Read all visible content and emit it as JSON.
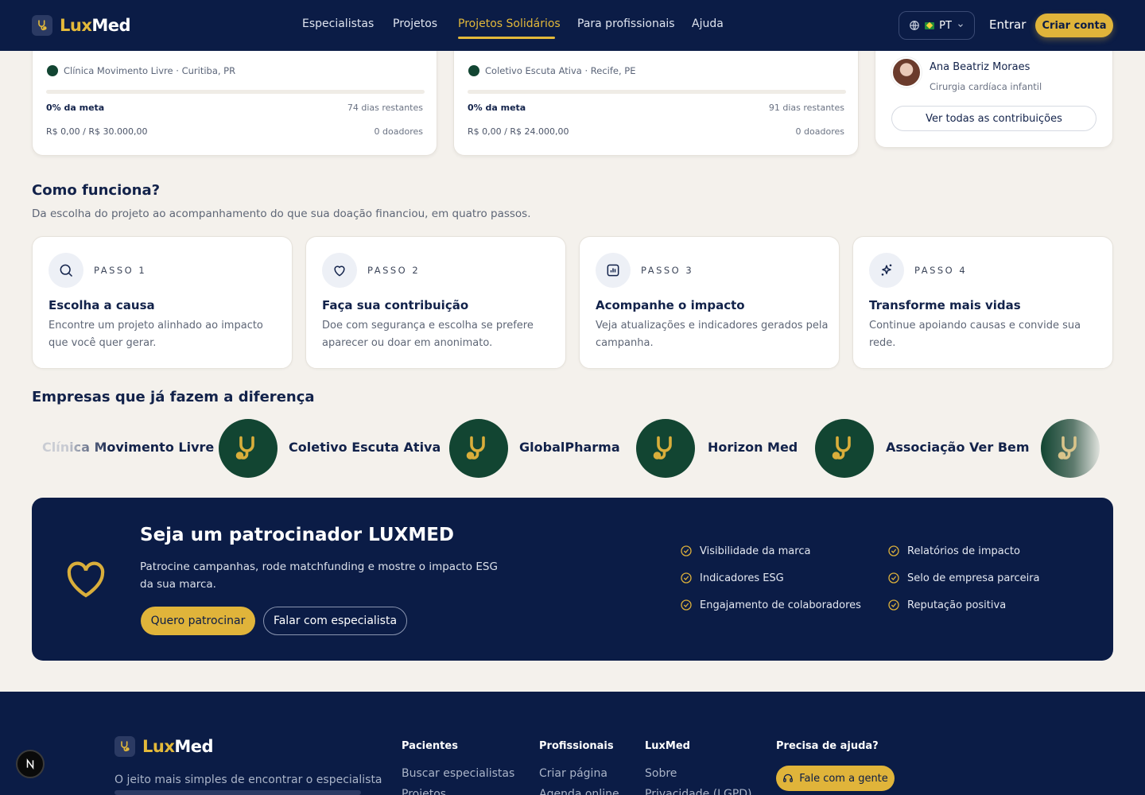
{
  "header": {
    "brand_lux": "Lux",
    "brand_med": "Med",
    "nav": [
      "Especialistas",
      "Projetos",
      "Projetos Solidários",
      "Para profissionais",
      "Ajuda"
    ],
    "lang": "PT",
    "login": "Entrar",
    "signup": "Criar conta"
  },
  "projects": [
    {
      "org": "Clínica Movimento Livre · Curitiba, PR",
      "percent": "0% da meta",
      "days": "74 dias restantes",
      "amount": "R$ 0,00 / R$ 30.000,00",
      "donors": "0 doadores",
      "progress": 0
    },
    {
      "org": "Coletivo Escuta Ativa · Recife, PE",
      "percent": "0% da meta",
      "days": "91 dias restantes",
      "amount": "R$ 0,00 / R$ 24.000,00",
      "donors": "0 doadores",
      "progress": 0
    }
  ],
  "contrib": {
    "name": "Ana Beatriz Moraes",
    "role": "Cirurgia cardíaca infantil",
    "button": "Ver todas as contribuições"
  },
  "how": {
    "title": "Como funciona?",
    "subtitle": "Da escolha do projeto ao acompanhamento do que sua doação financiou, em quatro passos.",
    "steps": [
      {
        "label": "PASSO 1",
        "title": "Escolha a causa",
        "desc1": "Encontre um projeto alinhado ao impacto",
        "desc2": "que você quer gerar.",
        "icon": "search-icon"
      },
      {
        "label": "PASSO 2",
        "title": "Faça sua contribuição",
        "desc1": "Doe com segurança e escolha se prefere",
        "desc2": "aparecer ou doar em anonimato.",
        "icon": "heart-icon"
      },
      {
        "label": "PASSO 3",
        "title": "Acompanhe o impacto",
        "desc1": "Veja atualizações e indicadores gerados pela",
        "desc2": "campanha.",
        "icon": "chart-icon"
      },
      {
        "label": "PASSO 4",
        "title": "Transforme mais vidas",
        "desc1": "Continue apoiando causas e convide sua",
        "desc2": "rede.",
        "icon": "sparkle-icon"
      }
    ]
  },
  "companies": {
    "title": "Empresas que já fazem a diferença",
    "items": [
      "Clínica Movimento Livre",
      "Coletivo Escuta Ativa",
      "GlobalPharma",
      "Horizon Med",
      "Associação Ver Bem"
    ]
  },
  "sponsor": {
    "title": "Seja um patrocinador LUXMED",
    "desc1": "Patrocine campanhas, rode matchfunding e mostre o impacto ESG",
    "desc2": "da sua marca.",
    "primary": "Quero patrocinar",
    "secondary": "Falar com especialista",
    "benefits": [
      "Visibilidade da marca",
      "Relatórios de impacto",
      "Indicadores ESG",
      "Selo de empresa parceira",
      "Engajamento de colaboradores",
      "Reputação positiva"
    ]
  },
  "footer": {
    "brand_lux": "Lux",
    "brand_med": "Med",
    "tagline": "O jeito mais simples de encontrar o especialista",
    "cols": [
      {
        "head": "Pacientes",
        "link1": "Buscar especialistas",
        "link2": "Projetos"
      },
      {
        "head": "Profissionais",
        "link1": "Criar página",
        "link2": "Agenda online"
      },
      {
        "head": "LuxMed",
        "link1": "Sobre",
        "link2": "Privacidade (LGPD)"
      }
    ],
    "help": "Precisa de ajuda?",
    "help_button": "Fale com a gente"
  },
  "colors": {
    "navy": "#0b1c46",
    "gold": "#e0b43a",
    "green": "#124532",
    "bg": "#f4f1ec"
  }
}
